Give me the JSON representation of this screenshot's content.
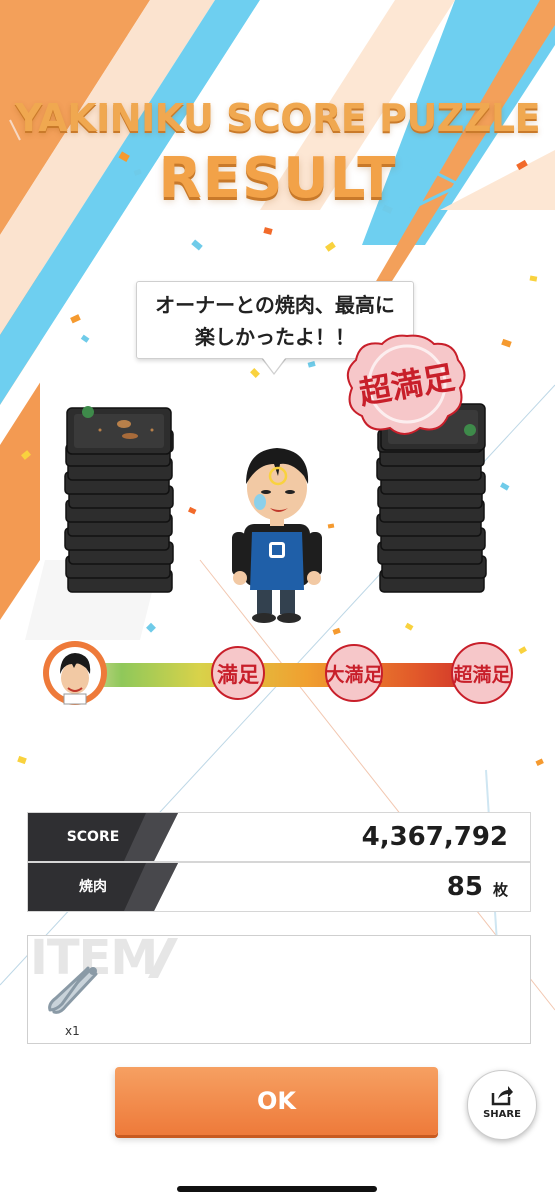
{
  "title": {
    "line1": "YAKINIKU SCORE PUZZLE",
    "line2": "RESULT"
  },
  "dialogue": {
    "line1": "オーナーとの焼肉、最高に",
    "line2": "楽しかったよ！！"
  },
  "stamp": {
    "text": "超満足"
  },
  "satisfaction_gauge": {
    "levels": [
      "満足",
      "大満足",
      "超満足"
    ],
    "achieved": "超満足",
    "fill_fraction": 1.0
  },
  "results": {
    "score_label": "SCORE",
    "score_value": "4,367,792",
    "meat_label": "焼肉",
    "meat_value": "85",
    "meat_unit": "枚"
  },
  "item": {
    "header": "ITEM",
    "icon": "tongs-icon",
    "quantity": "x1"
  },
  "buttons": {
    "ok_label": "OK",
    "share_label": "SHARE"
  },
  "colors": {
    "accent_orange": "#ee7a3a",
    "accent_blue": "#59c6ec",
    "stamp_red": "#c81f2a",
    "panel_dark": "#2b2b2d"
  }
}
